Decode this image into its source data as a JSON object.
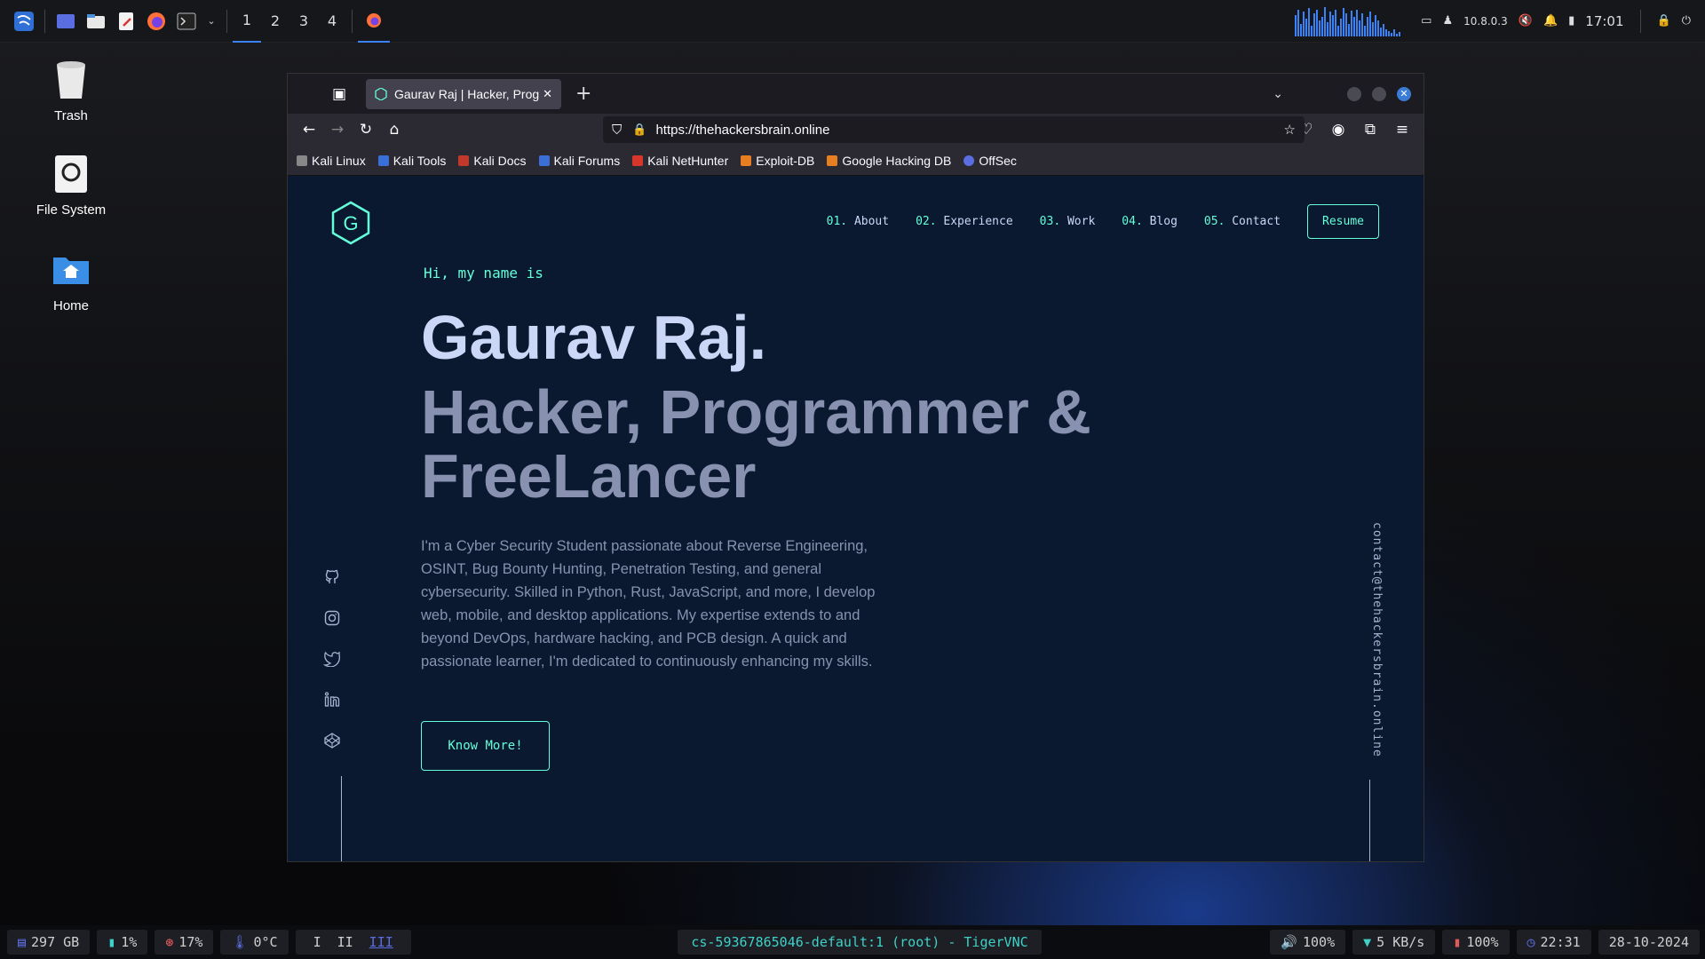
{
  "top_panel": {
    "workspaces": [
      "1",
      "2",
      "3",
      "4"
    ],
    "active_workspace": "1",
    "ip": "10.8.0.3",
    "time": "17:01"
  },
  "desktop": {
    "icons": [
      {
        "label": "Trash",
        "icon": "trash-icon"
      },
      {
        "label": "File System",
        "icon": "drive-icon"
      },
      {
        "label": "Home",
        "icon": "home-folder-icon"
      }
    ]
  },
  "browser": {
    "tab_title": "Gaurav Raj | Hacker, Prog",
    "url": "https://thehackersbrain.online",
    "bookmarks": [
      "Kali Linux",
      "Kali Tools",
      "Kali Docs",
      "Kali Forums",
      "Kali NetHunter",
      "Exploit-DB",
      "Google Hacking DB",
      "OffSec"
    ]
  },
  "site": {
    "logo_letter": "G",
    "nav": [
      {
        "num": "01.",
        "label": "About"
      },
      {
        "num": "02.",
        "label": "Experience"
      },
      {
        "num": "03.",
        "label": "Work"
      },
      {
        "num": "04.",
        "label": "Blog"
      },
      {
        "num": "05.",
        "label": "Contact"
      }
    ],
    "resume_label": "Resume",
    "greeting": "Hi, my name is",
    "name": "Gaurav Raj.",
    "tagline": "Hacker, Programmer & FreeLancer",
    "bio": "I'm a Cyber Security Student passionate about Reverse Engineering, OSINT, Bug Bounty Hunting, Penetration Testing, and general cybersecurity. Skilled in Python, Rust, JavaScript, and more, I develop web, mobile, and desktop applications. My expertise extends to and beyond DevOps, hardware hacking, and PCB design. A quick and passionate learner, I'm dedicated to continuously enhancing my skills.",
    "cta_label": "Know More!",
    "email": "contact@thehackersbrain.online",
    "socials": [
      "github-icon",
      "instagram-icon",
      "twitter-icon",
      "linkedin-icon",
      "codepen-icon"
    ]
  },
  "bottom_bar": {
    "disk": "297 GB",
    "cpu": "1%",
    "ram": "17%",
    "temp": "0°C",
    "workspaces": [
      "I",
      "II",
      "III"
    ],
    "title": "cs-59367865046-default:1 (root) - TigerVNC",
    "volume": "100%",
    "network": "5 KB/s",
    "battery": "100%",
    "clock": "22:31",
    "date": "28-10-2024"
  },
  "colors": {
    "accent": "#64ffda",
    "bg": "#0a192f",
    "heading": "#ccd6f6",
    "text": "#8892b0",
    "panel_accent": "#3b82f6"
  }
}
